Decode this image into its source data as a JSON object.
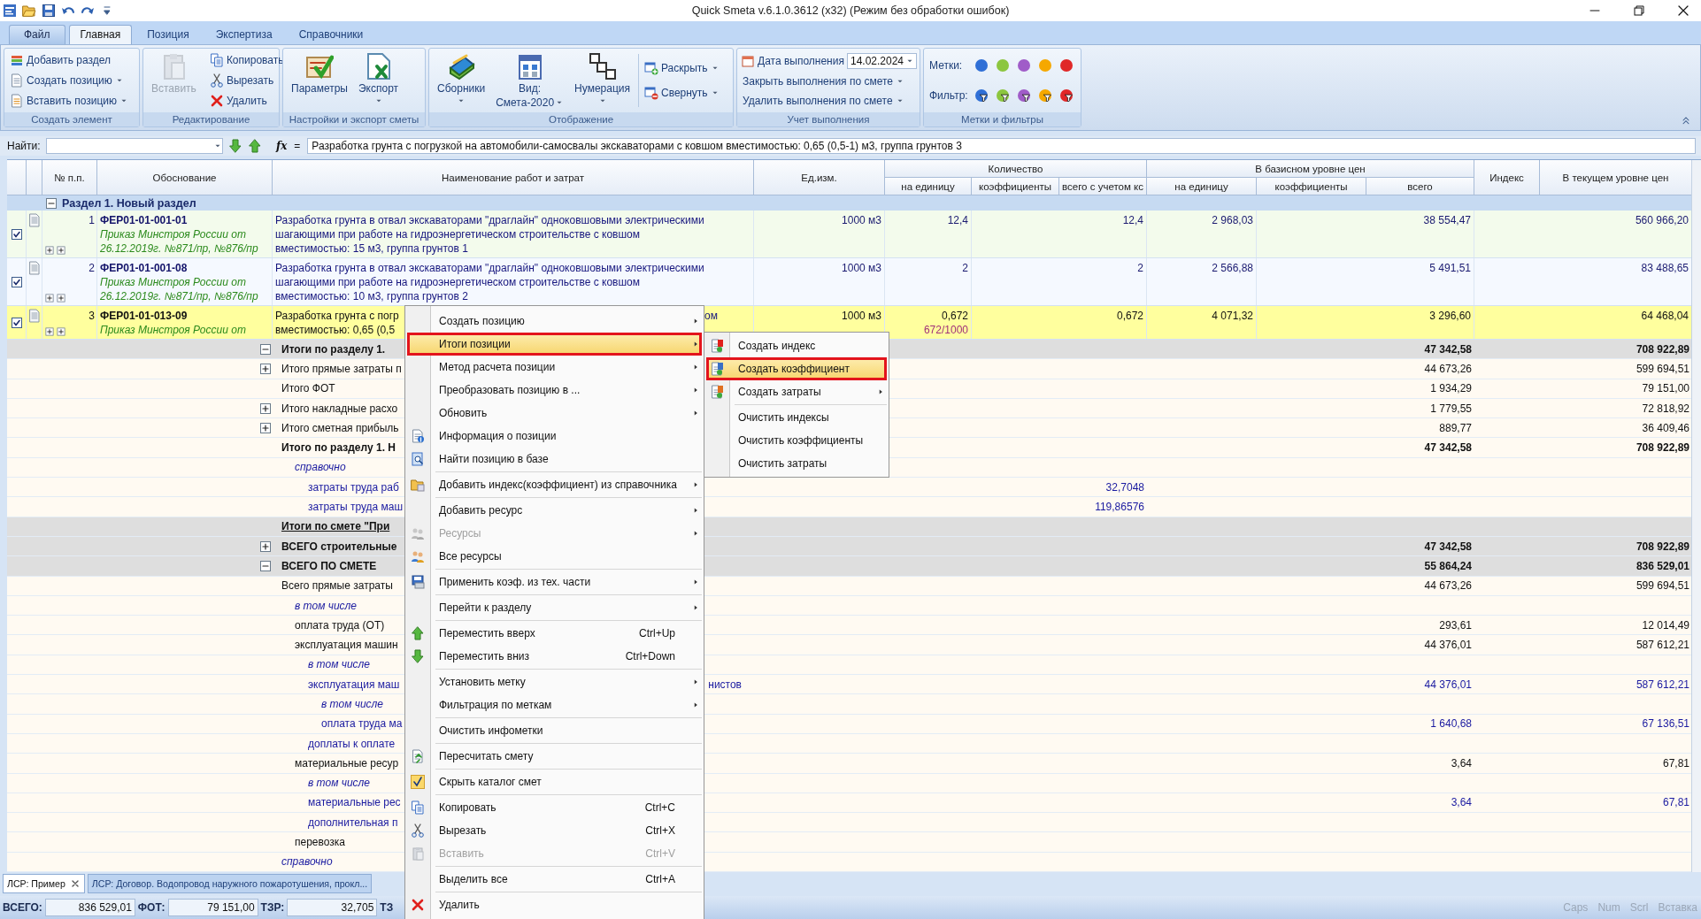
{
  "window": {
    "title": "Quick Smeta v.6.1.0.3612 (x32) (Режим без обработки ошибок)"
  },
  "ribbon": {
    "tabs": [
      {
        "label": "Файл",
        "selected": false
      },
      {
        "label": "Главная",
        "selected": true
      },
      {
        "label": "Позиция",
        "selected": false
      },
      {
        "label": "Экспертиза",
        "selected": false
      },
      {
        "label": "Справочники",
        "selected": false
      }
    ],
    "groups": [
      {
        "title": "Создать элемент",
        "small": [
          {
            "label": "Добавить раздел",
            "dropdown": false,
            "disabled": false
          },
          {
            "label": "Создать позицию",
            "dropdown": true,
            "disabled": false
          },
          {
            "label": "Вставить позицию",
            "dropdown": true,
            "disabled": false
          }
        ]
      },
      {
        "title": "Редактирование",
        "large": [
          {
            "label": "Вставить",
            "dropdown": false,
            "disabled": true
          }
        ],
        "small": [
          {
            "label": "Копировать",
            "dropdown": false,
            "disabled": false
          },
          {
            "label": "Вырезать",
            "dropdown": false,
            "disabled": false
          },
          {
            "label": "Удалить",
            "dropdown": false,
            "disabled": false
          }
        ]
      },
      {
        "title": "Настройки и экспорт сметы",
        "large": [
          {
            "label": "Параметры",
            "dropdown": false,
            "disabled": false
          },
          {
            "label": "Экспорт",
            "dropdown": true,
            "disabled": false
          }
        ]
      },
      {
        "title": "Отображение",
        "large": [
          {
            "label": "Сборники",
            "dropdown": true,
            "disabled": false
          },
          {
            "label": "Вид:",
            "sublabel": "Смета-2020",
            "dropdown": true,
            "disabled": false
          },
          {
            "label": "Нумерация",
            "dropdown": true,
            "disabled": false
          }
        ],
        "small": [
          {
            "label": "Раскрыть",
            "dropdown": true,
            "disabled": false
          },
          {
            "label": "Свернуть",
            "dropdown": true,
            "disabled": false
          }
        ]
      },
      {
        "title": "Учет выполнения",
        "date": {
          "label": "Дата выполнения",
          "value": "14.02.2024"
        },
        "small": [
          {
            "label": "Закрыть выполнения по смете",
            "dropdown": true,
            "disabled": false
          },
          {
            "label": "Удалить выполнения по смете",
            "dropdown": true,
            "disabled": false
          }
        ]
      },
      {
        "title": "Метки и фильтры",
        "marks": [
          {
            "label": "Метки:",
            "kind": "dot",
            "items": [
              {
                "color": "#2f6fd6"
              },
              {
                "color": "#8cc63f"
              },
              {
                "color": "#a05cc8"
              },
              {
                "color": "#f5a800"
              },
              {
                "color": "#e02828"
              }
            ]
          },
          {
            "label": "Фильтр:",
            "kind": "filter",
            "items": [
              {
                "color": "#2f6fd6"
              },
              {
                "color": "#8cc63f"
              },
              {
                "color": "#a05cc8"
              },
              {
                "color": "#f5a800"
              },
              {
                "color": "#e02828"
              }
            ]
          }
        ]
      }
    ]
  },
  "find_bar": {
    "label": "Найти:",
    "fx": "fx",
    "equals": "=",
    "formula": "Разработка грунта с погрузкой на автомобили-самосвалы экскаваторами с ковшом вместимостью: 0,65 (0,5-1) м3, группа грунтов 3"
  },
  "table": {
    "header": {
      "number": "№ п.п.",
      "basis": "Обоснование",
      "name": "Наименование работ и затрат",
      "unit": "Ед.изм.",
      "qty_group": "Количество",
      "qty_cols": [
        "на единицу",
        "коэффициенты",
        "всего с учетом кс"
      ],
      "base_group": "В базисном уровне цен",
      "base_cols": [
        "на единицу",
        "коэффициенты",
        "всего"
      ],
      "index": "Индекс",
      "current": "В текущем уровне цен"
    },
    "section": {
      "title": "Раздел 1. Новый раздел",
      "expanded": true
    },
    "items": [
      {
        "number": "1",
        "code": "ФЕР01-01-001-01",
        "basis_lines": [
          "Приказ Минстроя России от",
          "26.12.2019г. №871/пр, №876/пр"
        ],
        "name_lines": [
          "Разработка грунта в отвал экскаваторами \"драглайн\" одноковшовыми электрическими",
          "шагающими при работе на гидроэнергетическом строительстве с ковшом",
          "вместимостью: 15 м3, группа грунтов 1"
        ],
        "unit": "1000 м3",
        "qty_unit": "12,4",
        "qty_total": "12,4",
        "base_unit": "2 968,03",
        "base_total": "38 554,47",
        "current": "560 966,20",
        "checked": true,
        "selected": false
      },
      {
        "number": "2",
        "code": "ФЕР01-01-001-08",
        "basis_lines": [
          "Приказ Минстроя России от",
          "26.12.2019г. №871/пр, №876/пр"
        ],
        "name_lines": [
          "Разработка грунта в отвал экскаваторами \"драглайн\" одноковшовыми электрическими",
          "шагающими при работе на гидроэнергетическом строительстве с ковшом",
          "вместимостью: 10 м3, группа грунтов 2"
        ],
        "unit": "1000 м3",
        "qty_unit": "2",
        "qty_total": "2",
        "base_unit": "2 566,88",
        "base_total": "5 491,51",
        "current": "83 488,65",
        "checked": true,
        "selected": false
      },
      {
        "number": "3",
        "code": "ФЕР01-01-013-09",
        "basis_lines": [
          "Приказ Минстроя России от"
        ],
        "name_lines": [
          "Разработка грунта с погр",
          "вместимостью: 0,65 (0,5"
        ],
        "name_tail": "ом",
        "unit": "1000 м3",
        "qty_unit": "0,672",
        "qty_formula": "672/1000",
        "qty_total": "0,672",
        "base_unit": "4 071,32",
        "base_total": "3 296,60",
        "current": "64 468,04",
        "checked": true,
        "selected": true
      }
    ],
    "summary": [
      {
        "kind": "group",
        "label": "Итоги по разделу 1.",
        "expanded": true,
        "base_total": "47 342,58",
        "current": "708 922,89"
      },
      {
        "kind": "line",
        "label": "Итого прямые затраты п",
        "expanded": false,
        "base_total": "44 673,26",
        "current": "599 694,51"
      },
      {
        "kind": "line",
        "label": "Итого ФОТ",
        "base_total": "1 934,29",
        "current": "79 151,00"
      },
      {
        "kind": "line",
        "label": "Итого накладные расхо",
        "expanded": false,
        "base_total": "1 779,55",
        "current": "72 818,92"
      },
      {
        "kind": "line",
        "label": "Итого сметная прибыль",
        "expanded": false,
        "base_total": "889,77",
        "current": "36 409,46"
      },
      {
        "kind": "total",
        "label": "Итого по разделу 1. Н",
        "base_total": "47 342,58",
        "current": "708 922,89",
        "children": [
          {
            "kind": "note",
            "label": "справочно",
            "children": [
              {
                "kind": "detail",
                "label": "затраты труда раб",
                "qty_total": "32,7048"
              },
              {
                "kind": "detail",
                "label": "затраты труда маш",
                "qty_total": "119,86576"
              }
            ]
          }
        ]
      },
      {
        "kind": "heading",
        "label": "Итоги по смете \"При"
      },
      {
        "kind": "group",
        "label": "ВСЕГО строительные",
        "expanded": false,
        "base_total": "47 342,58",
        "current": "708 922,89"
      },
      {
        "kind": "group",
        "label": "ВСЕГО ПО СМЕТЕ",
        "expanded": true,
        "base_total": "55 864,24",
        "current": "836 529,01"
      },
      {
        "kind": "line",
        "label": "Всего прямые затраты",
        "base_total": "44 673,26",
        "current": "599 694,51",
        "children": [
          {
            "kind": "note",
            "label": "в том числе"
          },
          {
            "kind": "line",
            "label": "оплата труда (ОТ)",
            "base_total": "293,61",
            "current": "12 014,49"
          },
          {
            "kind": "line",
            "label": "эксплуатация машин",
            "base_total": "44 376,01",
            "current": "587 612,21",
            "children": [
              {
                "kind": "note",
                "label": "в том числе"
              },
              {
                "kind": "detail",
                "label": "эксплуатация маш",
                "tail": "нистов",
                "base_total": "44 376,01",
                "current": "587 612,21",
                "children": [
                  {
                    "kind": "note",
                    "label": "в том числе"
                  },
                  {
                    "kind": "detail",
                    "label": "оплата труда ма",
                    "base_total": "1 640,68",
                    "current": "67 136,51"
                  }
                ]
              },
              {
                "kind": "detail",
                "label": "доплаты к оплате"
              }
            ]
          },
          {
            "kind": "line",
            "label": "материальные ресур",
            "base_total": "3,64",
            "current": "67,81",
            "children": [
              {
                "kind": "note",
                "label": "в том числе"
              },
              {
                "kind": "detail",
                "label": "материальные рес",
                "base_total": "3,64",
                "current": "67,81"
              },
              {
                "kind": "detail",
                "label": "дополнительная п"
              }
            ]
          },
          {
            "kind": "line",
            "label": "перевозка"
          }
        ]
      },
      {
        "kind": "note",
        "label": "справочно"
      }
    ]
  },
  "context_menu": {
    "sections": [
      [
        {
          "label": "Создать позицию",
          "submenu": true,
          "disabled": false,
          "checked": false,
          "selected": false
        },
        {
          "label": "Итоги позиции",
          "submenu": true,
          "disabled": false,
          "checked": false,
          "selected": true
        },
        {
          "label": "Метод расчета позиции",
          "submenu": true,
          "disabled": false,
          "checked": false,
          "selected": false
        },
        {
          "label": "Преобразовать позицию в ...",
          "submenu": true,
          "disabled": false,
          "checked": false,
          "selected": false
        },
        {
          "label": "Обновить",
          "submenu": true,
          "disabled": false,
          "checked": false,
          "selected": false
        },
        {
          "label": "Информация о позиции",
          "submenu": false,
          "disabled": false,
          "checked": false,
          "selected": false
        },
        {
          "label": "Найти позицию в базе",
          "submenu": false,
          "disabled": false,
          "checked": false,
          "selected": false
        }
      ],
      [
        {
          "label": "Добавить индекс(коэффициент) из справочника",
          "submenu": true,
          "disabled": false,
          "checked": false,
          "selected": false
        }
      ],
      [
        {
          "label": "Добавить ресурс",
          "submenu": true,
          "disabled": false,
          "checked": false,
          "selected": false
        },
        {
          "label": "Ресурсы",
          "submenu": true,
          "disabled": true,
          "checked": false,
          "selected": false
        },
        {
          "label": "Все ресурсы",
          "submenu": false,
          "disabled": false,
          "checked": false,
          "selected": false
        }
      ],
      [
        {
          "label": "Применить коэф. из тех. части",
          "submenu": true,
          "disabled": false,
          "checked": false,
          "selected": false
        }
      ],
      [
        {
          "label": "Перейти к разделу",
          "submenu": true,
          "disabled": false,
          "checked": false,
          "selected": false
        }
      ],
      [
        {
          "label": "Переместить вверх",
          "shortcut": "Ctrl+Up",
          "submenu": false,
          "disabled": false,
          "checked": false,
          "selected": false
        },
        {
          "label": "Переместить вниз",
          "shortcut": "Ctrl+Down",
          "submenu": false,
          "disabled": false,
          "checked": false,
          "selected": false
        }
      ],
      [
        {
          "label": "Установить метку",
          "submenu": true,
          "disabled": false,
          "checked": false,
          "selected": false
        },
        {
          "label": "Фильтрация по меткам",
          "submenu": true,
          "disabled": false,
          "checked": false,
          "selected": false
        }
      ],
      [
        {
          "label": "Очистить инфометки",
          "submenu": false,
          "disabled": false,
          "checked": false,
          "selected": false
        }
      ],
      [
        {
          "label": "Пересчитать смету",
          "submenu": false,
          "disabled": false,
          "checked": false,
          "selected": false
        }
      ],
      [
        {
          "label": "Скрыть каталог смет",
          "submenu": false,
          "disabled": false,
          "checked": true,
          "selected": false
        }
      ],
      [
        {
          "label": "Копировать",
          "shortcut": "Ctrl+C",
          "submenu": false,
          "disabled": false,
          "checked": false,
          "selected": false
        },
        {
          "label": "Вырезать",
          "shortcut": "Ctrl+X",
          "submenu": false,
          "disabled": false,
          "checked": false,
          "selected": false
        },
        {
          "label": "Вставить",
          "shortcut": "Ctrl+V",
          "submenu": false,
          "disabled": true,
          "checked": false,
          "selected": false
        }
      ],
      [
        {
          "label": "Выделить все",
          "shortcut": "Ctrl+A",
          "submenu": false,
          "disabled": false,
          "checked": false,
          "selected": false
        }
      ],
      [
        {
          "label": "Удалить",
          "submenu": false,
          "disabled": false,
          "checked": false,
          "selected": false
        }
      ]
    ]
  },
  "submenu": {
    "sections": [
      [
        {
          "label": "Создать индекс",
          "submenu": false,
          "selected": false
        },
        {
          "label": "Создать коэффициент",
          "submenu": false,
          "selected": true
        },
        {
          "label": "Создать затраты",
          "submenu": true,
          "selected": false
        }
      ],
      [
        {
          "label": "Очистить индексы",
          "submenu": false,
          "selected": false
        },
        {
          "label": "Очистить коэффициенты",
          "submenu": false,
          "selected": false
        },
        {
          "label": "Очистить затраты",
          "submenu": false,
          "selected": false
        }
      ]
    ]
  },
  "doc_tabs": [
    {
      "label": "ЛСР: Пример",
      "selected": true,
      "closable": true
    },
    {
      "label": "ЛСР: Договор. Водопровод наружного пожаротушения, прокл...",
      "selected": false,
      "closable": false
    }
  ],
  "status_bar": {
    "fields": [
      {
        "label": "ВСЕГО:",
        "value": "836 529,01"
      },
      {
        "label": "ФОТ:",
        "value": "79 151,00"
      },
      {
        "label": "ТЗР:",
        "value": "32,705"
      },
      {
        "label": "ТЗ"
      }
    ],
    "indicators": [
      {
        "label": "Caps",
        "on": false
      },
      {
        "label": "Num",
        "on": false
      },
      {
        "label": "Scrl",
        "on": false
      },
      {
        "label": "Вставка",
        "on": false
      }
    ]
  }
}
